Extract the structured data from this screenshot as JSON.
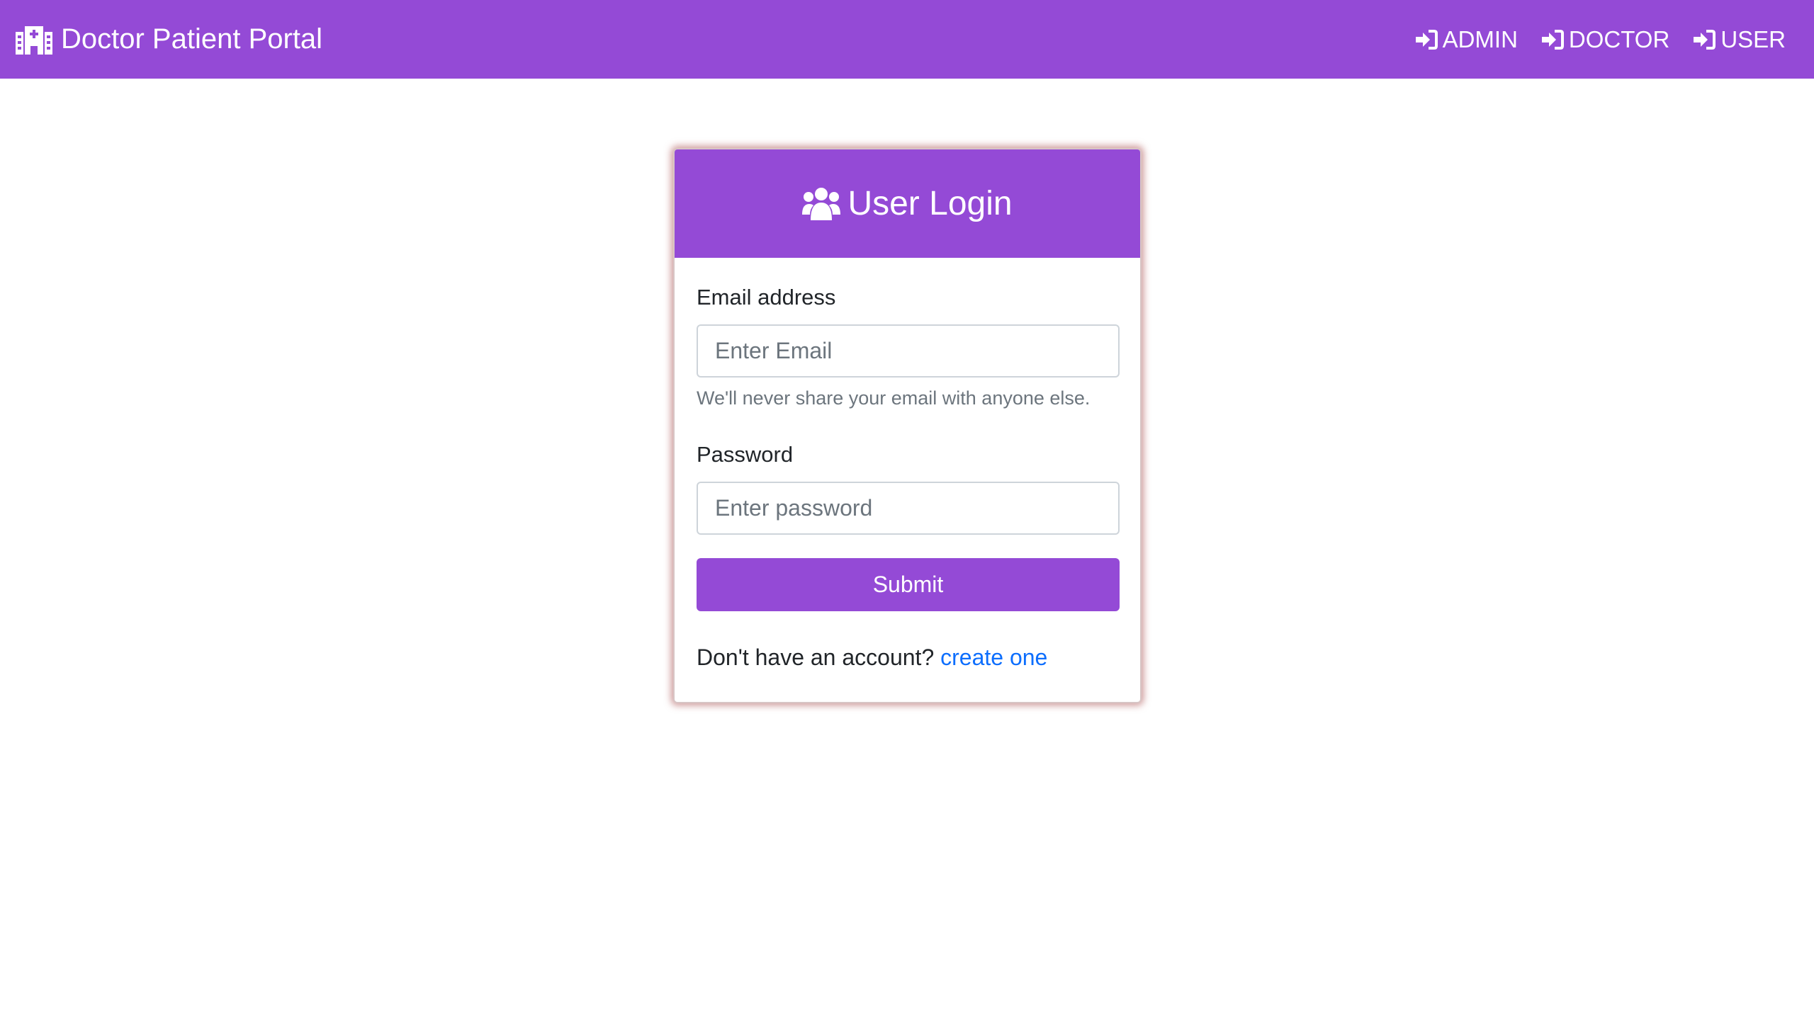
{
  "navbar": {
    "brand_label": "Doctor Patient Portal",
    "brand_icon": "hospital-icon",
    "links": [
      {
        "label": "ADMIN",
        "icon": "sign-in-icon"
      },
      {
        "label": "DOCTOR",
        "icon": "sign-in-icon"
      },
      {
        "label": "USER",
        "icon": "sign-in-icon"
      }
    ]
  },
  "login": {
    "title": "User Login",
    "title_icon": "users-icon",
    "email_label": "Email address",
    "email_placeholder": "Enter Email",
    "email_value": "",
    "email_help": "We'll never share your email with anyone else.",
    "password_label": "Password",
    "password_placeholder": "Enter password",
    "password_value": "",
    "submit_label": "Submit",
    "signup_prompt": "Don't have an account?",
    "signup_link": "create one"
  },
  "colors": {
    "accent": "#944ad6",
    "link": "#0d6efd",
    "card_glow": "#a54646"
  }
}
